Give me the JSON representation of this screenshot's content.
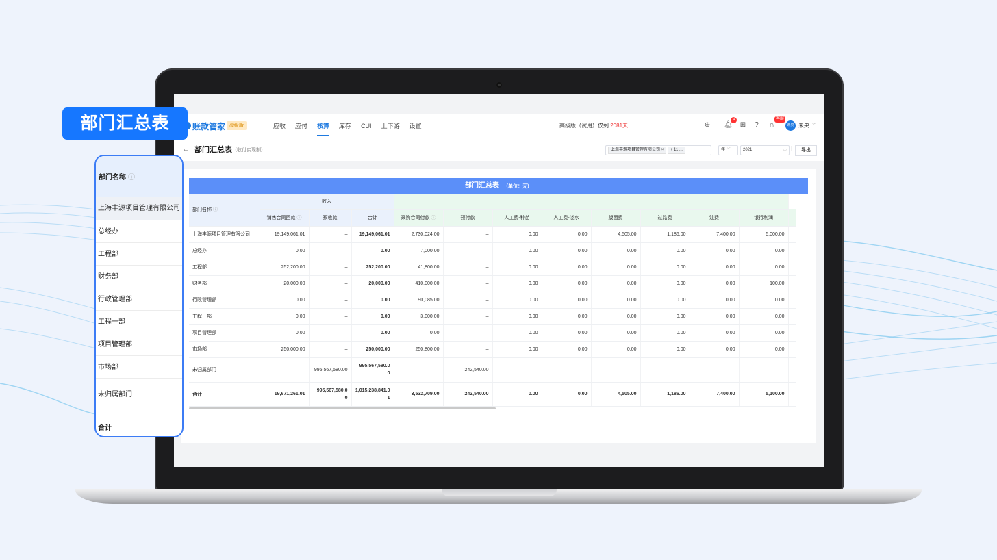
{
  "callout": {
    "title": "部门汇总表"
  },
  "app": {
    "brand": "账款管家",
    "edition_badge": "高级版",
    "nav": [
      "应收",
      "应付",
      "核算",
      "库存",
      "CUI",
      "上下游",
      "设置"
    ],
    "active_nav": "核算",
    "trial_prefix": "高级版（试用）仅剩",
    "trial_days": "2081天",
    "notification_count": "4",
    "support_badge": "客服",
    "avatar_text": "未央",
    "user_name": "未央"
  },
  "page": {
    "title": "部门汇总表",
    "subtitle": "（收付实现制）",
    "filter_company": "上海丰源项目管理有限公司",
    "filter_more": "+ 11 ...",
    "period_type": "年",
    "year": "2021",
    "export_label": "导出"
  },
  "table": {
    "title": "部门汇总表",
    "unit": "（单位：元）",
    "col_name": "部门名称",
    "income_group": "收入",
    "columns": [
      "销售合同回款",
      "预收款",
      "合计",
      "采购合同付款",
      "预付款",
      "人工费-种苗",
      "人工费-浇水",
      "版面费",
      "过路费",
      "油费",
      "银行利润"
    ],
    "rows": [
      {
        "name": "上海丰源项目管理有限公司",
        "values": [
          "19,149,061.01",
          "–",
          "19,149,061.01",
          "2,730,024.00",
          "–",
          "0.00",
          "0.00",
          "4,505.00",
          "1,186.00",
          "7,400.00",
          "5,000.00"
        ]
      },
      {
        "name": "总经办",
        "values": [
          "0.00",
          "–",
          "0.00",
          "7,000.00",
          "–",
          "0.00",
          "0.00",
          "0.00",
          "0.00",
          "0.00",
          "0.00"
        ]
      },
      {
        "name": "工程部",
        "values": [
          "252,200.00",
          "–",
          "252,200.00",
          "41,800.00",
          "–",
          "0.00",
          "0.00",
          "0.00",
          "0.00",
          "0.00",
          "0.00"
        ]
      },
      {
        "name": "财务部",
        "values": [
          "20,000.00",
          "–",
          "20,000.00",
          "410,000.00",
          "–",
          "0.00",
          "0.00",
          "0.00",
          "0.00",
          "0.00",
          "100.00"
        ]
      },
      {
        "name": "行政管理部",
        "values": [
          "0.00",
          "–",
          "0.00",
          "90,085.00",
          "–",
          "0.00",
          "0.00",
          "0.00",
          "0.00",
          "0.00",
          "0.00"
        ]
      },
      {
        "name": "工程一部",
        "values": [
          "0.00",
          "–",
          "0.00",
          "3,000.00",
          "–",
          "0.00",
          "0.00",
          "0.00",
          "0.00",
          "0.00",
          "0.00"
        ]
      },
      {
        "name": "项目管理部",
        "values": [
          "0.00",
          "–",
          "0.00",
          "0.00",
          "–",
          "0.00",
          "0.00",
          "0.00",
          "0.00",
          "0.00",
          "0.00"
        ]
      },
      {
        "name": "市场部",
        "values": [
          "250,000.00",
          "–",
          "250,000.00",
          "250,800.00",
          "–",
          "0.00",
          "0.00",
          "0.00",
          "0.00",
          "0.00",
          "0.00"
        ]
      },
      {
        "name": "未归属部门",
        "values": [
          "–",
          "995,567,580.00",
          "995,567,580.0\n0",
          "–",
          "242,540.00",
          "–",
          "–",
          "–",
          "–",
          "–",
          "–"
        ]
      },
      {
        "name": "合计",
        "values": [
          "19,671,261.01",
          "995,567,580.0\n0",
          "1,015,238,841.0\n1",
          "3,532,709.00",
          "242,540.00",
          "0.00",
          "0.00",
          "4,505.00",
          "1,186.00",
          "7,400.00",
          "5,100.00"
        ]
      }
    ]
  },
  "zoom_panel": {
    "header": "部门名称",
    "rows": [
      "上海丰源项目管理有限公司",
      "总经办",
      "工程部",
      "财务部",
      "行政管理部",
      "工程一部",
      "项目管理部",
      "市场部",
      "未归属部门",
      "合计"
    ]
  },
  "colors": {
    "accent": "#1677ff",
    "table_header": "#5b8ff9",
    "income_bg": "#eaf1fc",
    "expense_bg": "#e9f8ee"
  }
}
